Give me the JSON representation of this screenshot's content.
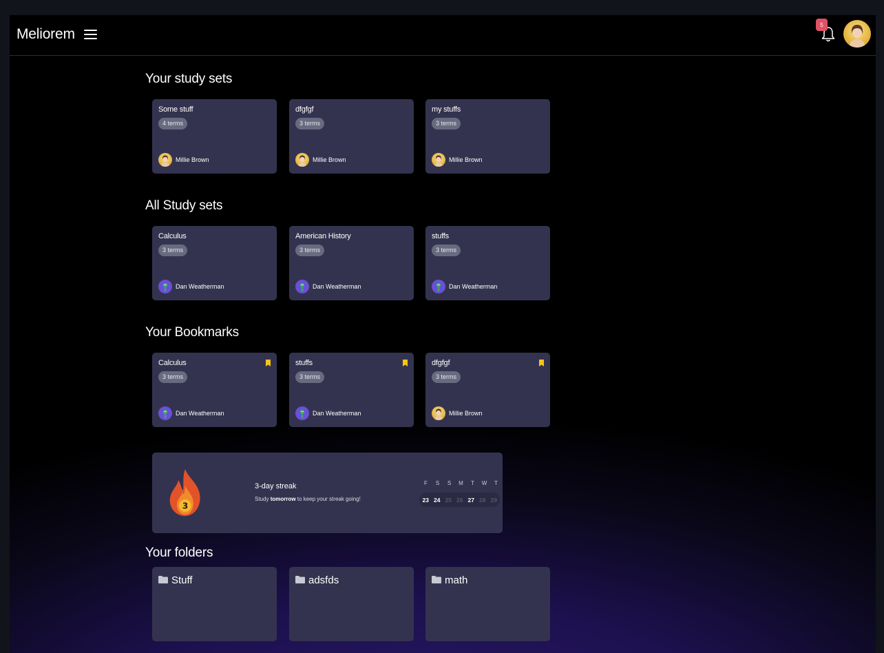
{
  "header": {
    "brand": "Meliorem",
    "notification_count": "5"
  },
  "your_study_sets": {
    "title": "Your study sets",
    "cards": [
      {
        "title": "Some stuff",
        "terms": "4 terms",
        "owner": "Millie Brown"
      },
      {
        "title": "dfgfgf",
        "terms": "3 terms",
        "owner": "Millie Brown"
      },
      {
        "title": "my stuffs",
        "terms": "3 terms",
        "owner": "Millie Brown"
      }
    ]
  },
  "all_study_sets": {
    "title": "All Study sets",
    "cards": [
      {
        "title": "Calculus",
        "terms": "3 terms",
        "owner": "Dan Weatherman"
      },
      {
        "title": "American History",
        "terms": "3 terms",
        "owner": "Dan Weatherman"
      },
      {
        "title": "stuffs",
        "terms": "3 terms",
        "owner": "Dan Weatherman"
      }
    ]
  },
  "bookmarks": {
    "title": "Your Bookmarks",
    "cards": [
      {
        "title": "Calculus",
        "terms": "3 terms",
        "owner": "Dan Weatherman"
      },
      {
        "title": "stuffs",
        "terms": "3 terms",
        "owner": "Dan Weatherman"
      },
      {
        "title": "dfgfgf",
        "terms": "3 terms",
        "owner": "Millie Brown"
      }
    ]
  },
  "streak": {
    "count": "3",
    "title": "3-day streak",
    "subtitle_prefix": "Study ",
    "subtitle_bold": "tomorrow",
    "subtitle_suffix": " to keep your streak going!",
    "days": [
      "F",
      "S",
      "S",
      "M",
      "T",
      "W",
      "T"
    ],
    "dates": [
      {
        "value": "23",
        "active": true
      },
      {
        "value": "24",
        "active": true
      },
      {
        "value": "25",
        "active": false
      },
      {
        "value": "26",
        "active": false
      },
      {
        "value": "27",
        "active": true
      },
      {
        "value": "28",
        "active": false
      },
      {
        "value": "29",
        "active": false
      }
    ]
  },
  "folders": {
    "title": "Your folders",
    "items": [
      {
        "name": "Stuff"
      },
      {
        "name": "adsfds"
      },
      {
        "name": "math"
      }
    ]
  },
  "colors": {
    "card_bg": "#34334f",
    "badge_red": "#e05263",
    "bookmark_yellow": "#f5c518",
    "flame_orange": "#e2532a"
  }
}
